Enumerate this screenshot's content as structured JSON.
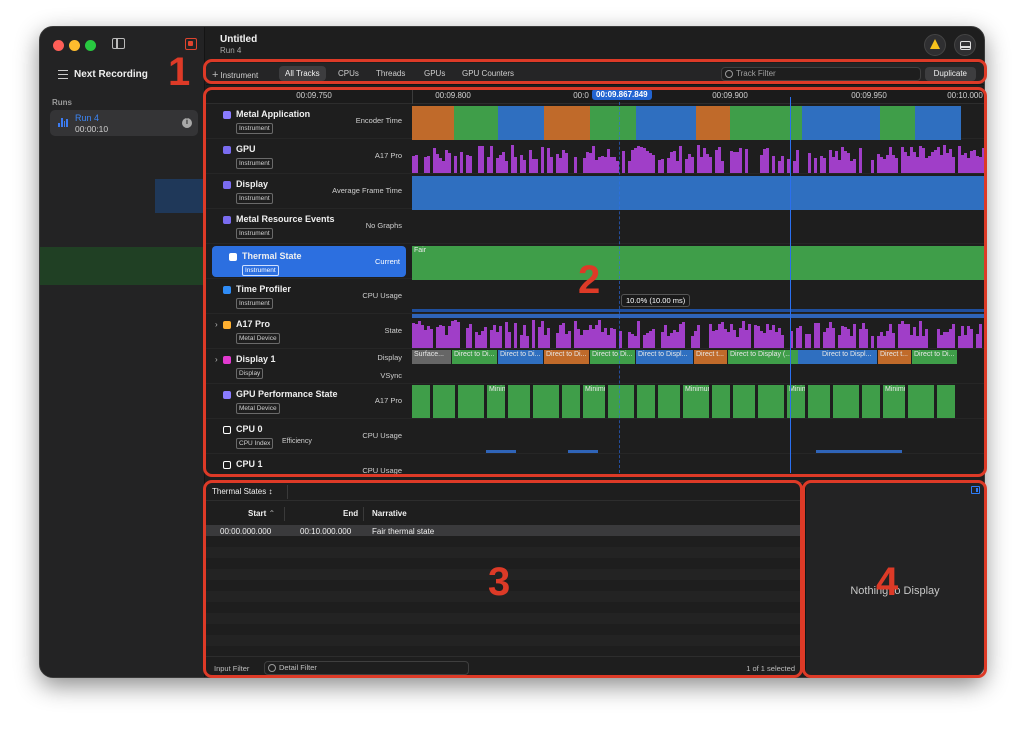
{
  "sidebar": {
    "next_recording": "Next Recording",
    "runs_header": "Runs",
    "run": {
      "name": "Run 4",
      "time": "00:00:10"
    }
  },
  "titlebar": {
    "title": "Untitled",
    "subtitle": "Run 4"
  },
  "filterbar": {
    "instrument": "Instrument",
    "tabs": [
      "All Tracks",
      "CPUs",
      "Threads",
      "GPUs",
      "GPU Counters"
    ],
    "track_filter_placeholder": "Track Filter",
    "duplicate": "Duplicate"
  },
  "ruler": {
    "ticks": [
      "00:09.750",
      "00:09.800",
      "00:0",
      "00:09.900",
      "00:09.950",
      "00:10.000"
    ],
    "playhead": "00:09.867.849"
  },
  "tracks": [
    {
      "name": "Metal Application",
      "badge": "Instrument",
      "mode": "Encoder Time",
      "icon_color": "#8a7cff"
    },
    {
      "name": "GPU",
      "badge": "Instrument",
      "mode": "A17 Pro",
      "icon_color": "#7a6cf0"
    },
    {
      "name": "Display",
      "badge": "Instrument",
      "mode": "Average Frame Time",
      "icon_color": "#7a6cf0"
    },
    {
      "name": "Metal Resource Events",
      "badge": "Instrument",
      "mode": "No Graphs",
      "icon_color": "#7a6cf0"
    },
    {
      "name": "Thermal State",
      "badge": "Instrument",
      "mode": "Current",
      "icon_color": "#ffffff"
    },
    {
      "name": "Time Profiler",
      "badge": "Instrument",
      "mode": "CPU Usage",
      "icon_color": "#2f8cf6"
    },
    {
      "name": "A17 Pro",
      "badge": "Metal Device",
      "mode": "State",
      "icon_color": "#ffb030"
    },
    {
      "name": "Display 1",
      "badge": "Display",
      "mode": "Display",
      "mode2": "VSync",
      "icon_color": "#e23ad0"
    },
    {
      "name": "GPU Performance State",
      "badge": "Metal Device",
      "mode": "A17 Pro",
      "icon_color": "#8a7cff"
    },
    {
      "name": "CPU 0",
      "badge": "CPU Index",
      "badge2": "Efficiency",
      "mode": "CPU Usage",
      "icon_color": "#ffffff"
    },
    {
      "name": "CPU 1",
      "badge": "",
      "mode": "CPU Usage",
      "icon_color": "#ffffff"
    }
  ],
  "graph_labels": {
    "thermal": "Fair",
    "tooltip": "10.0% (10.00 ms)",
    "display_segments": [
      "Surface...",
      "Direct to Di...",
      "Direct to Di...",
      "Direct to Di...",
      "Direct to Di...",
      "Direct to Displ...",
      "Direct t...",
      "Direct to Display (...",
      "Direct to Displ...",
      "Direct t...",
      "Direct to Di..."
    ],
    "gpu_perf": "Minimum"
  },
  "detail": {
    "selector": "Thermal States",
    "columns": [
      "Start",
      "End",
      "Narrative"
    ],
    "rows": [
      {
        "start": "00:00.000.000",
        "end": "00:10.000.000",
        "narrative": "Fair thermal state"
      }
    ],
    "input_filter": "Input Filter",
    "detail_filter_placeholder": "Detail Filter",
    "selection_count": "1 of 1 selected"
  },
  "inspector": {
    "empty": "Nothing to Display"
  },
  "annotations": [
    "1",
    "2",
    "3",
    "4"
  ],
  "colors": {
    "accent": "#2c6fe0",
    "annotation": "#dd3a27",
    "green": "#3f9e49",
    "blue": "#2f6fc0",
    "purple": "#a03ec8",
    "orange": "#c06a2a"
  }
}
